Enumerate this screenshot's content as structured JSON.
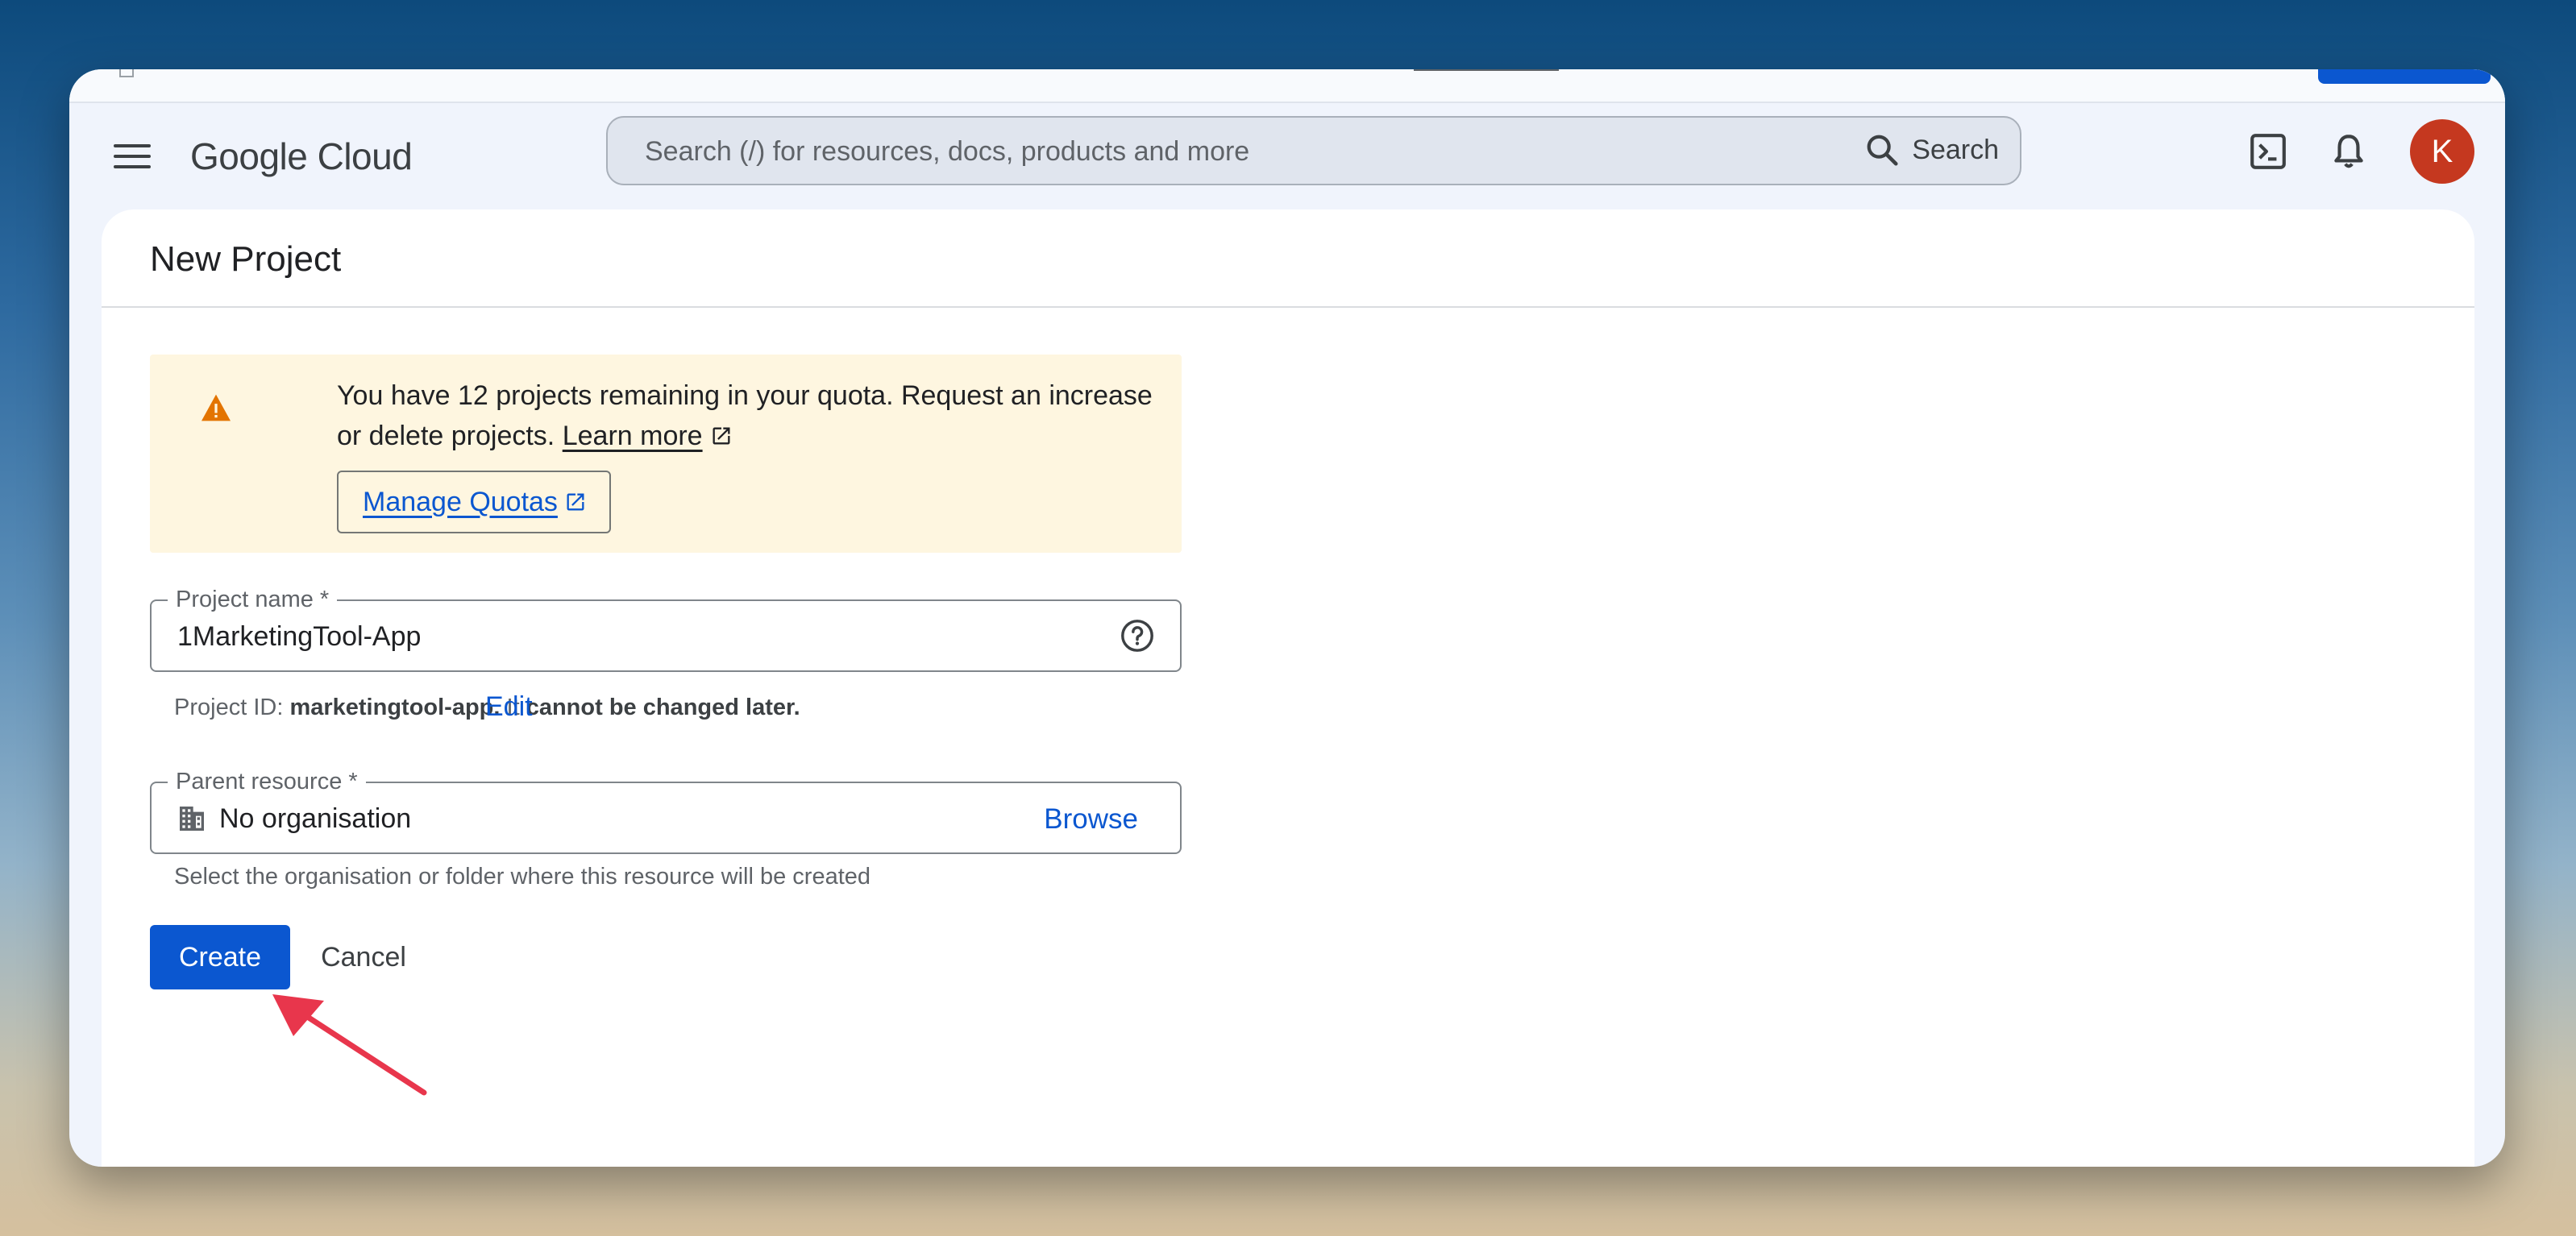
{
  "app": {
    "brand": "Google Cloud"
  },
  "search": {
    "placeholder": "Search (/) for resources, docs, products and more",
    "button_label": "Search"
  },
  "user": {
    "avatar_initial": "K"
  },
  "page": {
    "title": "New Project"
  },
  "quota_alert": {
    "message": "You have 12 projects remaining in your quota. Request an increase or delete projects.",
    "learn_more": "Learn more",
    "manage_quotas": "Manage Quotas"
  },
  "form": {
    "project_name": {
      "label": "Project name *",
      "value": "1MarketingTool-App"
    },
    "project_id": {
      "prefix": "Project ID:",
      "id": "marketingtool-app.",
      "middle": "It",
      "strong": "cannot be changed later.",
      "edit": "Edit"
    },
    "parent_resource": {
      "label": "Parent resource *",
      "value": "No organisation",
      "browse": "Browse",
      "helper": "Select the organisation or folder where this resource will be created"
    }
  },
  "actions": {
    "create": "Create",
    "cancel": "Cancel"
  },
  "colors": {
    "primary": "#0b57d0",
    "avatar": "#c5381f",
    "warning": "#e37400",
    "alert_bg": "#fef6e0",
    "annotation_arrow": "#e8364c"
  },
  "icons": {
    "menu": "menu-icon",
    "search": "search-icon",
    "terminal": "cloud-shell-icon",
    "notifications": "bell-icon",
    "more": "more-vert-icon",
    "warning": "warning-icon",
    "external": "open-in-new-icon",
    "help": "help-icon",
    "org": "building-icon"
  }
}
